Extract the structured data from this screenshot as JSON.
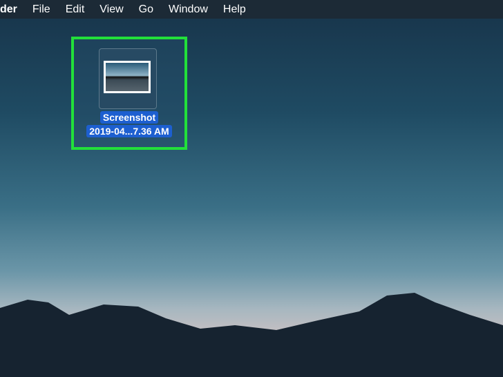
{
  "menubar": {
    "app": "der",
    "items": [
      "File",
      "Edit",
      "View",
      "Go",
      "Window",
      "Help"
    ]
  },
  "desktop_icon": {
    "name_line1": "Screenshot",
    "name_line2": "2019-04...7.36 AM"
  }
}
